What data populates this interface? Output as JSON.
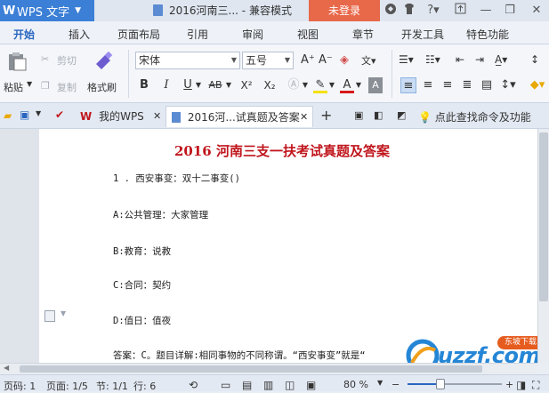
{
  "titlebar": {
    "app_name": "WPS 文字",
    "doc_title": "2016河南三... - 兼容模式",
    "login": "未登录",
    "icons": [
      "skin-icon",
      "shirt-icon",
      "help-icon",
      "pin-icon",
      "minimize-icon",
      "restore-icon",
      "close-icon"
    ]
  },
  "ribbon_tabs": [
    "开始",
    "插入",
    "页面布局",
    "引用",
    "审阅",
    "视图",
    "章节",
    "开发工具",
    "特色功能"
  ],
  "ribbon": {
    "paste": "粘贴",
    "cut": "剪切",
    "copy": "复制",
    "format_painter": "格式刷",
    "font_name": "宋体",
    "font_size": "五号",
    "bold": "B",
    "italic": "I",
    "underline": "U",
    "strike": "AB",
    "superscript": "X²",
    "subscript": "X₂",
    "font_color": "A"
  },
  "doc_tabs": {
    "wps_home": "我的WPS",
    "active_doc": "2016河...试真题及答案",
    "command_search": "点此查找命令及功能"
  },
  "document": {
    "heading": "2016 河南三支一扶考试真题及答案",
    "paragraphs": [
      "1 . 西安事变：双十二事变()",
      "A:公共管理：大家管理",
      "B:教育：说教",
      "C:合同：契约",
      "D:值日：值夜",
      "答案：C。题目详解:相同事物的不同称谓。“西安事变”就是“"
    ]
  },
  "watermark": {
    "text": "uzzf.com",
    "badge": "东坡下载"
  },
  "statusbar": {
    "line": "页码: 1",
    "page": "页面: 1/5",
    "section": "节: 1/1",
    "row": "行: 6",
    "zoom": "80 %",
    "zoom_fraction": 0.35
  }
}
